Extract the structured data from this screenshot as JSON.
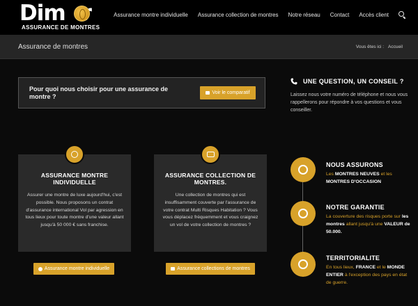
{
  "header": {
    "logo_word": "Dim",
    "logo_word_end": "r",
    "logo_sub": "ASSURANCE DE MONTRES",
    "nav": [
      "Assurance montre individuelle",
      "Assurance collection de montres",
      "Notre réseau",
      "Contact",
      "Accès client"
    ]
  },
  "titlebar": {
    "title": "Assurance de montres",
    "breadcrumb_prefix": "Vous êtes ici :",
    "breadcrumb_current": "Accueil"
  },
  "why": {
    "text": "Pour quoi nous choisir pour une assurance de montre ?",
    "button": "Voir le comparatif"
  },
  "question": {
    "title": "UNE QUESTION, UN CONSEIL ?",
    "text": "Laissez nous votre numéro de téléphone et nous vous rappellerons pour répondre à vos questions et vous conseiller."
  },
  "cards": [
    {
      "title": "ASSURANCE MONTRE INDIVIDUELLE",
      "body": "Assurer une montre de luxe aujourd'hui, c'est possible. Nous proposons un contrat d'assurance international Vol par agression en tous lieux pour toute montre d'une valeur allant jusqu'à 50 000 € sans franchise.",
      "button": "Assurance montre individuelle"
    },
    {
      "title": "ASSURANCE COLLECTION DE MONTRES.",
      "body": "Une collection de montres qui est insuffisamment couverte par l'assurance de votre contrat Multi Risques Habitation ? Vous vous déplacez fréquemment et vous craignez un vol de votre collection de montres ?",
      "button": "Assurance collections de montres"
    }
  ],
  "features": [
    {
      "title": "NOUS ASSURONS",
      "p1": "Les ",
      "b1": "MONTRES NEUVES",
      "p2": " et les ",
      "b2": "MONTRES D'OCCASION",
      "p3": ""
    },
    {
      "title": "NOTRE GARANTIE",
      "p1": "La couverture des risques porte sur ",
      "b1": "les montres",
      "p2": " allant jusqu'à une ",
      "b2": "VALEUR de 50.000.",
      "p3": ""
    },
    {
      "title": "TERRITORIALITE",
      "p1": "En tous lieux, ",
      "b1": "FRANCE",
      "p2": " et le ",
      "b2": "MONDE ENTIER",
      "p3": " à l'exception des pays en état de guerre."
    }
  ],
  "colors": {
    "accent": "#d8a22a",
    "background": "#0b0b0b",
    "card": "#2a2a2a",
    "bar": "#262626"
  }
}
